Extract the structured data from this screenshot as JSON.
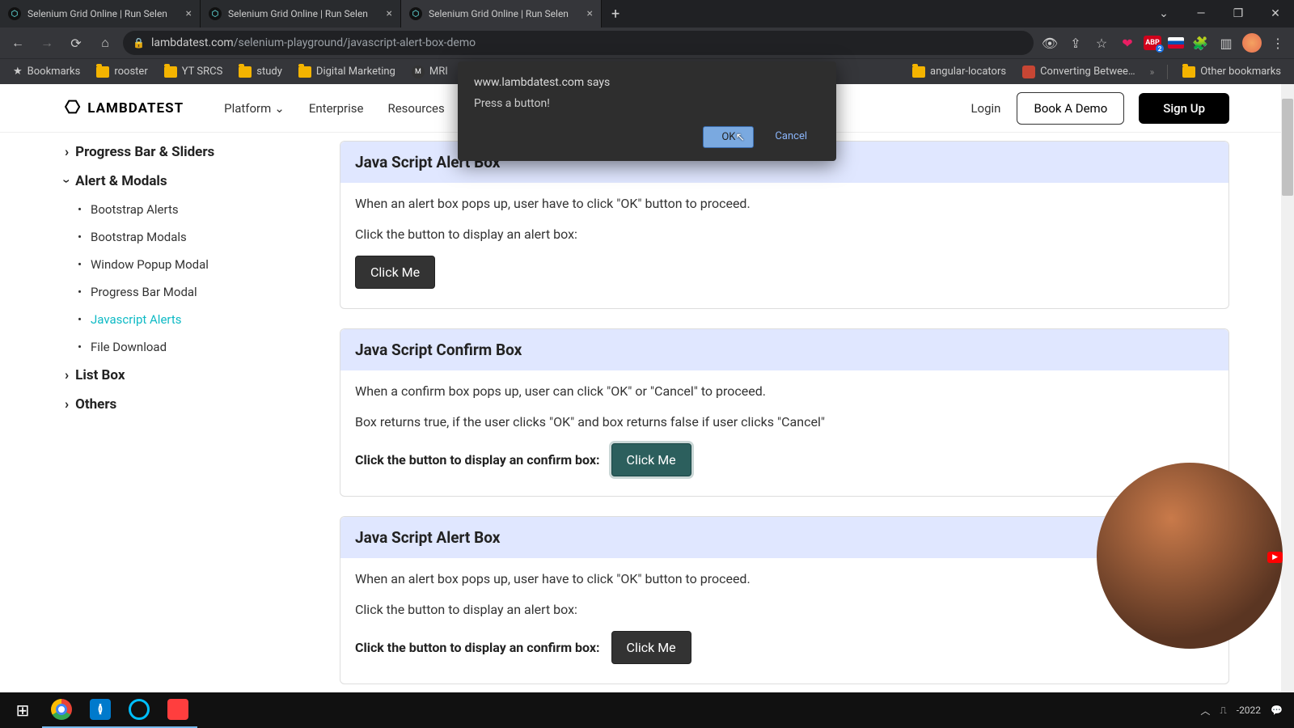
{
  "window": {
    "tabs": [
      {
        "title": "Selenium Grid Online | Run Selen"
      },
      {
        "title": "Selenium Grid Online | Run Selen"
      },
      {
        "title": "Selenium Grid Online | Run Selen"
      }
    ],
    "url_host": "lambdatest.com",
    "url_path": "/selenium-playground/javascript-alert-box-demo"
  },
  "bookmarks": {
    "items": [
      "Bookmarks",
      "rooster",
      "YT SRCS",
      "study",
      "Digital Marketing",
      "MRI"
    ],
    "right_items": [
      "angular-locators",
      "Converting Betwee…"
    ],
    "other": "Other bookmarks"
  },
  "dialog": {
    "origin": "www.lambdatest.com says",
    "message": "Press a button!",
    "ok": "OK",
    "cancel": "Cancel"
  },
  "header": {
    "logo": "LAMBDATEST",
    "nav": [
      "Platform",
      "Enterprise",
      "Resources"
    ],
    "login": "Login",
    "book_demo": "Book A Demo",
    "signup": "Sign Up"
  },
  "sidebar": {
    "groups": [
      {
        "label": "Progress Bar & Sliders",
        "open": false
      },
      {
        "label": "Alert & Modals",
        "open": true,
        "items": [
          "Bootstrap Alerts",
          "Bootstrap Modals",
          "Window Popup Modal",
          "Progress Bar Modal",
          "Javascript Alerts",
          "File Download"
        ],
        "active_index": 4
      },
      {
        "label": "List Box",
        "open": false
      },
      {
        "label": "Others",
        "open": false
      }
    ]
  },
  "cards": [
    {
      "title": "Java Script Alert Box",
      "p1": "When an alert box pops up, user have to click \"OK\" button to proceed.",
      "p2": "Click the button to display an alert box:",
      "button": "Click Me"
    },
    {
      "title": "Java Script Confirm Box",
      "p1": "When a confirm box pops up, user can click \"OK\" or \"Cancel\" to proceed.",
      "p2": "Box returns true, if the user clicks \"OK\" and box returns false if user clicks \"Cancel\"",
      "strong": "Click the button to display an confirm box:",
      "button": "Click Me"
    },
    {
      "title": "Java Script Alert Box",
      "p1": "When an alert box pops up, user have to click \"OK\" button to proceed.",
      "p2": "Click the button to display an alert box:",
      "strong": "Click the button to display an confirm box:",
      "button": "Click Me"
    }
  ],
  "taskbar": {
    "date": "-2022"
  },
  "abp_badge": "2"
}
